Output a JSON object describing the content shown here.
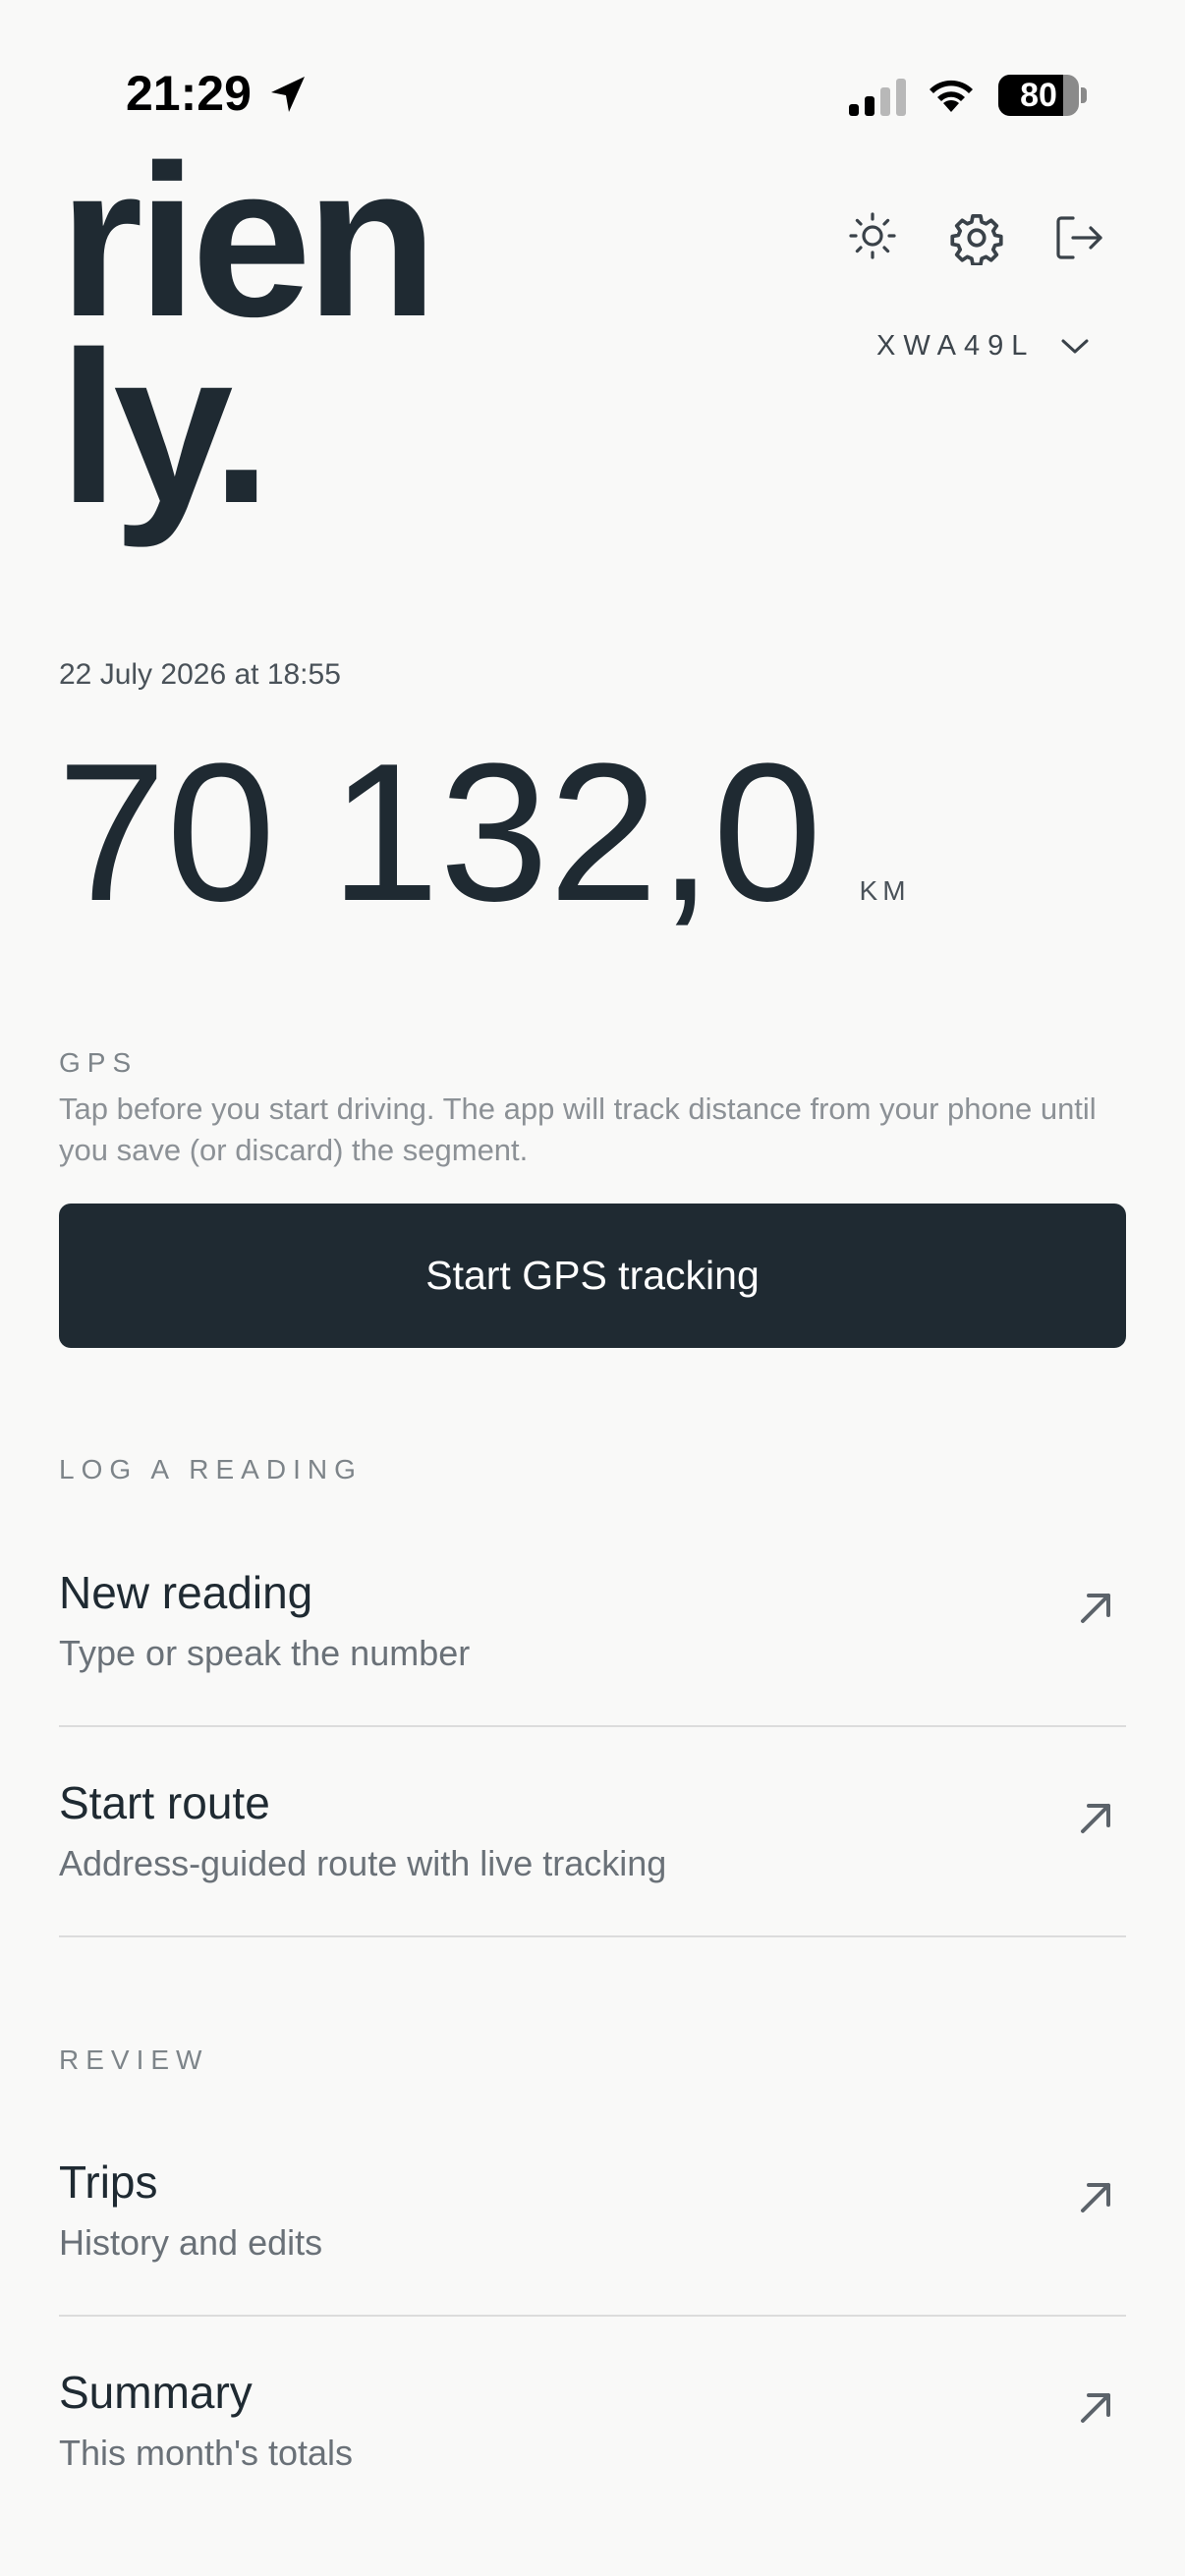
{
  "status_bar": {
    "time": "21:29",
    "battery_percent": "80",
    "battery_level": 0.8,
    "icons": [
      "location-arrow-icon",
      "cellular-signal-icon",
      "wifi-icon",
      "battery-icon"
    ]
  },
  "header": {
    "logo_line1": "rien",
    "logo_line2": "ly.",
    "icons": [
      "sun-icon",
      "gear-icon",
      "logout-icon"
    ],
    "vehicle": "XWA49L"
  },
  "reading": {
    "timestamp": "22 July 2026 at 18:55",
    "value": "70 132,0",
    "unit": "KM"
  },
  "gps": {
    "label": "GPS",
    "description": "Tap before you start driving. The app will track distance from your phone until you save (or discard) the segment.",
    "button_label": "Start GPS tracking"
  },
  "log_section": {
    "label": "LOG A READING",
    "items": [
      {
        "title": "New reading",
        "subtitle": "Type or speak the number"
      },
      {
        "title": "Start route",
        "subtitle": "Address-guided route with live tracking"
      }
    ]
  },
  "review_section": {
    "label": "REVIEW",
    "items": [
      {
        "title": "Trips",
        "subtitle": "History and edits"
      },
      {
        "title": "Summary",
        "subtitle": "This month's totals"
      }
    ]
  },
  "colors": {
    "background": "#f9f9f8",
    "primary": "#1f2a32",
    "muted": "#8c9196",
    "divider": "#dcdcdc"
  }
}
